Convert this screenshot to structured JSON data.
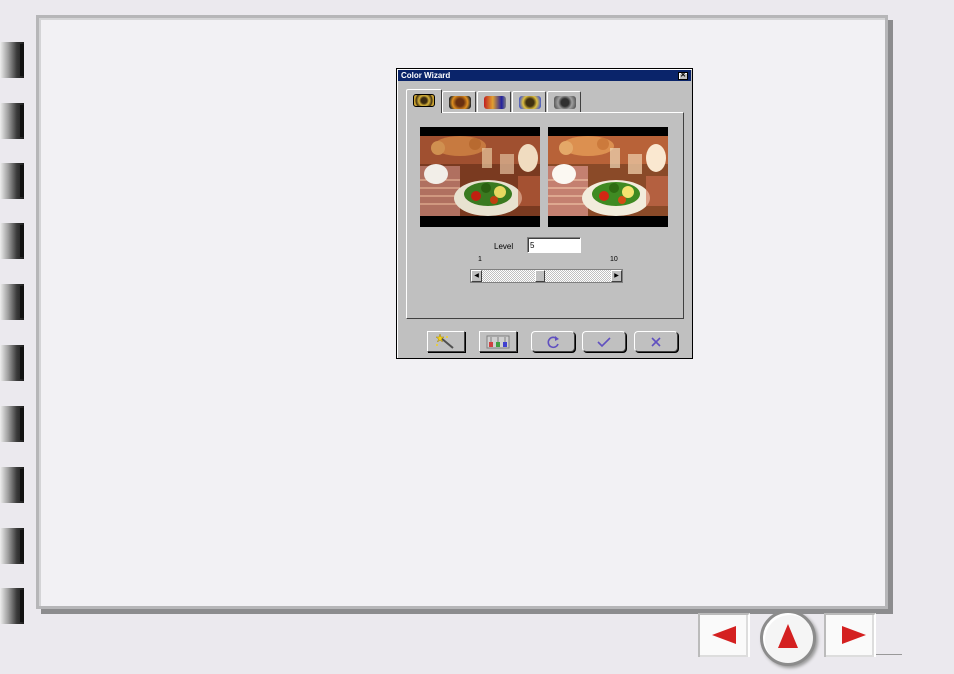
{
  "dialog": {
    "title": "Color Wizard",
    "close_label": "✕",
    "tabs": [
      {
        "icon": "auto-adjust-icon"
      },
      {
        "icon": "brightness-icon"
      },
      {
        "icon": "color-balance-icon"
      },
      {
        "icon": "saturation-icon"
      },
      {
        "icon": "grayscale-icon"
      }
    ],
    "level": {
      "label": "Level",
      "value": "5",
      "min_label": "1",
      "max_label": "10",
      "slider_value": 5,
      "slider_min": 1,
      "slider_max": 10
    },
    "buttons": [
      {
        "icon": "magic-wand-icon"
      },
      {
        "icon": "color-channels-icon"
      },
      {
        "icon": "reset-icon"
      },
      {
        "icon": "ok-checkmark-icon"
      },
      {
        "icon": "cancel-x-icon"
      }
    ]
  },
  "navigation": {
    "prev": "previous-page-arrow",
    "home": "up-home-arrow",
    "next": "next-page-arrow"
  },
  "colors": {
    "titlebar": "#0a246a",
    "nav_arrow": "#d42020",
    "icon_stroke": "#6050c0"
  }
}
